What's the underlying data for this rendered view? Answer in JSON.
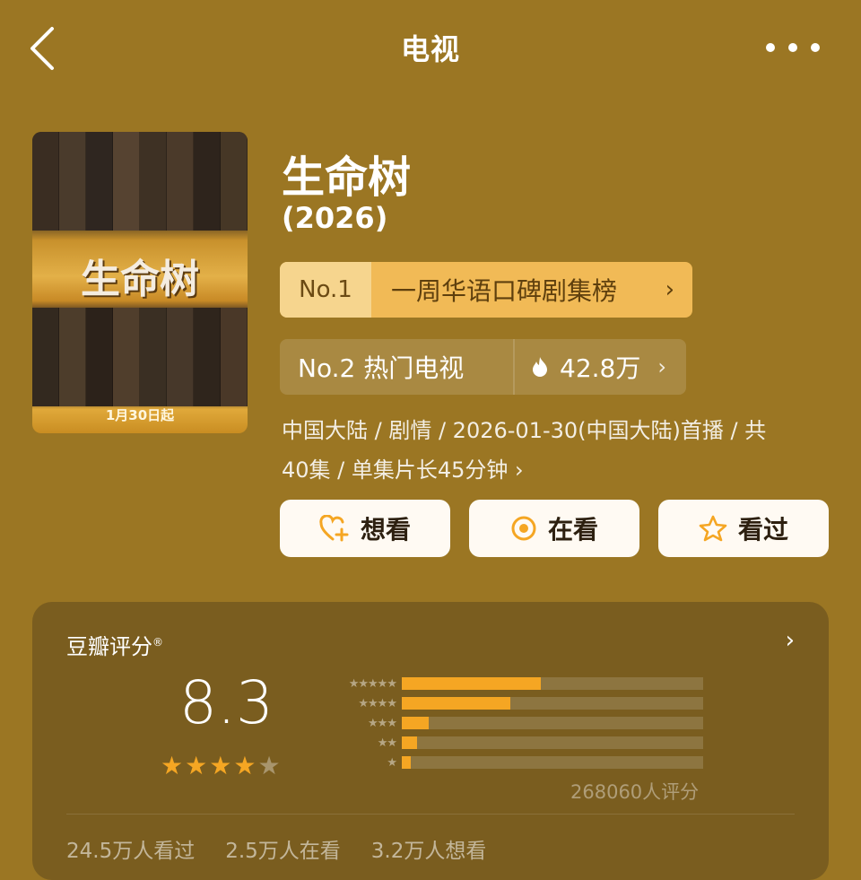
{
  "header": {
    "title": "电视",
    "back_icon": "chevron-left-icon",
    "more_icon": "more-dots-icon"
  },
  "poster": {
    "title_art": "生命树",
    "date_text": "1月30日起"
  },
  "show": {
    "name": "生命树",
    "year": "(2026)"
  },
  "rank_primary": {
    "no": "No.1",
    "label": "一周华语口碑剧集榜",
    "chevron": "›"
  },
  "rank_secondary": {
    "label": "No.2 热门电视",
    "hot_value": "42.8万",
    "chevron": "›"
  },
  "meta": {
    "line1": "中国大陆 / 剧情 / 2026-01-30(中国大陆)首播 / 共",
    "line2": "40集 / 单集片长45分钟 ›"
  },
  "actions": {
    "want_label": "想看",
    "watching_label": "在看",
    "watched_label": "看过"
  },
  "rating": {
    "heading": "豆瓣评分",
    "reg_mark": "®",
    "score": "8.3",
    "stars": [
      1,
      1,
      1,
      1,
      0
    ],
    "distribution": [
      {
        "stars": "★★★★★",
        "fraction": 0.46
      },
      {
        "stars": "★★★★",
        "fraction": 0.36
      },
      {
        "stars": "★★★",
        "fraction": 0.09
      },
      {
        "stars": "★★",
        "fraction": 0.05
      },
      {
        "stars": "★",
        "fraction": 0.03
      }
    ],
    "count_text": "268060人评分",
    "star_on_color": "#f5a623"
  },
  "stats": {
    "watched": "24.5万人看过",
    "watching": "2.5万人在看",
    "want": "3.2万人想看"
  }
}
